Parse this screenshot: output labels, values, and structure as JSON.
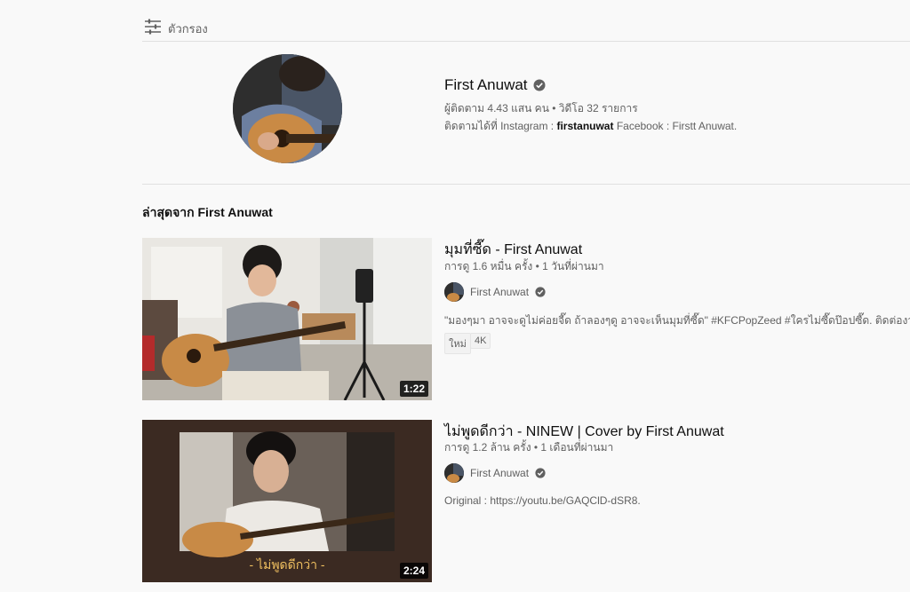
{
  "filter": {
    "label": "ตัวกรอง"
  },
  "channel": {
    "name": "First Anuwat",
    "meta": "ผู้ติดตาม 4.43 แสน คน • วิดีโอ 32 รายการ",
    "desc_prefix": "ติดตามได้ที่ Instagram : ",
    "desc_handle": "firstanuwat",
    "desc_suffix": " Facebook : Firstt Anuwat."
  },
  "section": {
    "title": "ล่าสุดจาก First Anuwat"
  },
  "videos": [
    {
      "title": "มุมที่ซี๊ด - First Anuwat",
      "meta": "การดู 1.6 หมื่น ครั้ง • 1 วันที่ผ่านมา",
      "channel": "First Anuwat",
      "description": "\"มองๆมา อาจจะดูไม่ค่อยจี๊ด ถ้าลองๆดู อาจจะเห็นมุมที่ซี๊ด\" #KFCPopZeed #ใครไม่ซี๊ดป๊อปซี๊ด. ติดต่องานโชว์ :",
      "badges": [
        "ใหม่",
        "4K"
      ],
      "duration": "1:22"
    },
    {
      "title": "ไม่พูดดีกว่า - NINEW | Cover by First Anuwat",
      "meta": "การดู 1.2 ล้าน ครั้ง • 1 เดือนที่ผ่านมา",
      "channel": "First Anuwat",
      "description": "Original : https://youtu.be/GAQClD-dSR8.",
      "overlay_caption": "- ไม่พูดดีกว่า -",
      "duration": "2:24"
    }
  ]
}
